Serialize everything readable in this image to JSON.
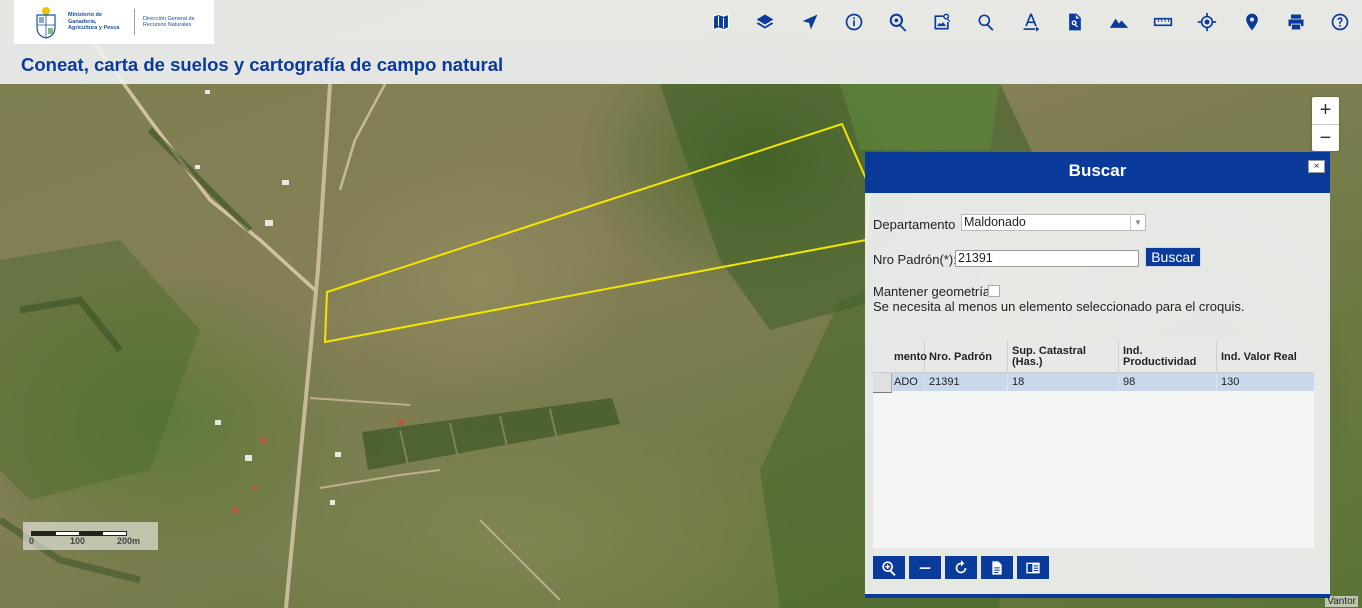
{
  "header": {
    "ministry": "Ministerio de Ganadería, Agricultura y Pesca",
    "direccion": "Dirección General de Recursos Naturales",
    "title": "Coneat, carta de suelos y cartografía de campo natural"
  },
  "toolbar": [
    {
      "name": "map-icon"
    },
    {
      "name": "layers-icon"
    },
    {
      "name": "navigate-icon"
    },
    {
      "name": "info-icon"
    },
    {
      "name": "map-search-icon"
    },
    {
      "name": "image-search-icon"
    },
    {
      "name": "search-icon"
    },
    {
      "name": "text-icon"
    },
    {
      "name": "document-search-icon"
    },
    {
      "name": "terrain-icon"
    },
    {
      "name": "ruler-icon"
    },
    {
      "name": "location-target-icon"
    },
    {
      "name": "map-pin-icon"
    },
    {
      "name": "print-icon"
    },
    {
      "name": "help-icon"
    }
  ],
  "zoom": {
    "in": "+",
    "out": "−"
  },
  "scale": {
    "labels": [
      "0",
      "100",
      "200m"
    ]
  },
  "attribution": "Vantor",
  "dialog": {
    "title": "Buscar",
    "close": "×",
    "departamento_label": "Departamento",
    "departamento_value": "Maldonado",
    "padron_label": "Nro Padrón(*):",
    "padron_value": "21391",
    "buscar_button": "Buscar",
    "mantener_label": "Mantener geometría",
    "mantener_checked": false,
    "hint": "Se necesita al menos un elemento seleccionado para el croquis.",
    "table": {
      "columns": [
        "mento",
        "Nro. Padrón",
        "Sup. Catastral (Has.)",
        "Ind. Productividad",
        "Ind. Valor Real"
      ],
      "rows": [
        [
          "ADO",
          "21391",
          "18",
          "98",
          "130"
        ]
      ]
    }
  },
  "colors": {
    "primary": "#0a3a9a",
    "polygon": "#f2e600"
  }
}
